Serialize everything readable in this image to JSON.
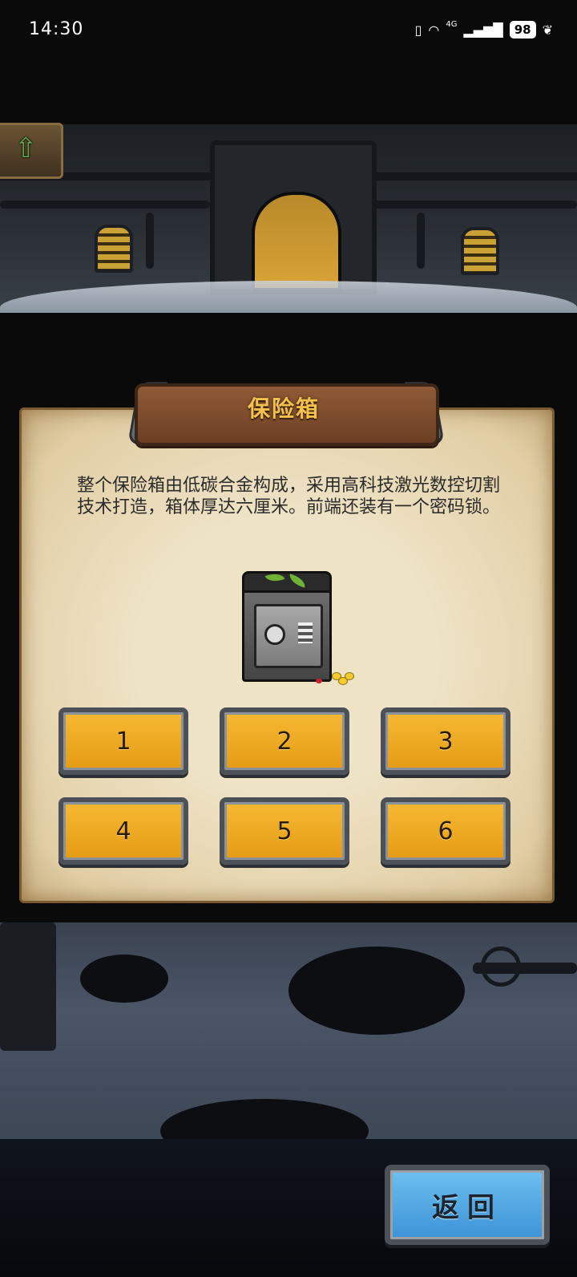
{
  "status_bar": {
    "time": "14:30",
    "network": "4G",
    "battery": "98",
    "icons": [
      "vibrate-icon",
      "wifi-icon",
      "signal-icon",
      "battery-icon",
      "leaf-icon"
    ]
  },
  "top_nav": {
    "up_icon": "up-arrow-icon"
  },
  "dialog": {
    "title": "保险箱",
    "description": "整个保险箱由低碳合金构成，采用高科技激光数控切割技术打造，箱体厚达六厘米。前端还装有一个密码锁。",
    "item_icon": "safe-icon"
  },
  "keypad": {
    "keys": [
      "1",
      "2",
      "3",
      "4",
      "5",
      "6"
    ]
  },
  "back_button": {
    "label": "返回"
  },
  "colors": {
    "key_fill": "#f2ad25",
    "title_text": "#f2c14e",
    "back_button": "#4aa3e0",
    "parchment": "#ead9b5"
  }
}
